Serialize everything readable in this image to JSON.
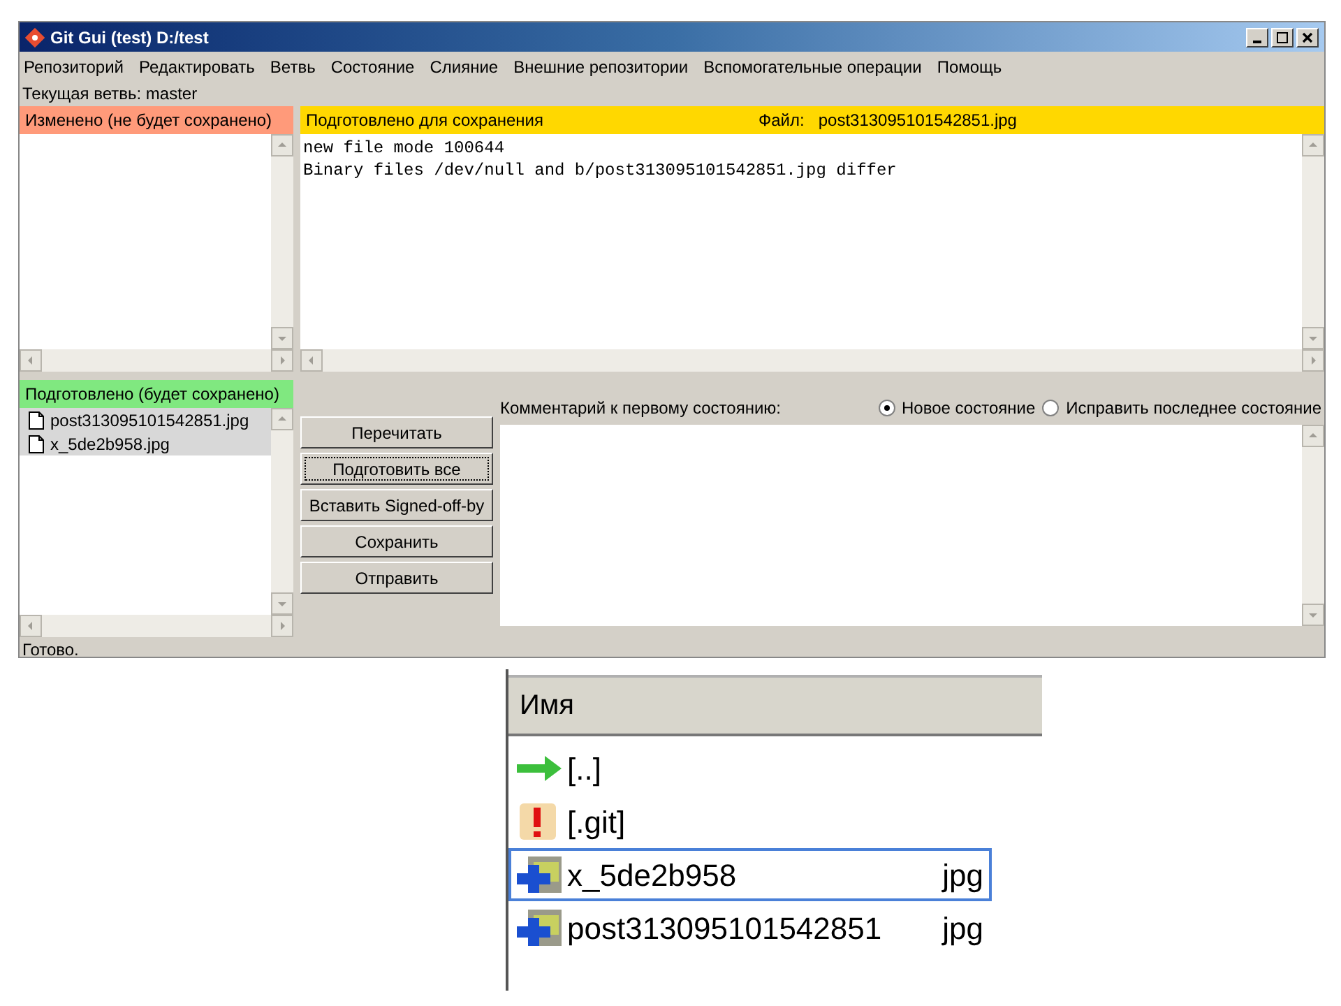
{
  "window": {
    "title": "Git Gui (test) D:/test"
  },
  "menu": [
    "Репозиторий",
    "Редактировать",
    "Ветвь",
    "Состояние",
    "Слияние",
    "Внешние репозитории",
    "Вспомогательные операции",
    "Помощь"
  ],
  "branch": "Текущая ветвь: master",
  "unstaged": {
    "title": "Изменено (не будет сохранено)"
  },
  "diff": {
    "title": "Подготовлено для сохранения",
    "file_label": "Файл:",
    "file": "post313095101542851.jpg",
    "lines": [
      "new file mode 100644",
      "Binary files /dev/null and b/post313095101542851.jpg differ"
    ]
  },
  "staged": {
    "title": "Подготовлено (будет сохранено)",
    "files": [
      {
        "name": "post313095101542851.jpg",
        "selected": true
      },
      {
        "name": "x_5de2b958.jpg",
        "selected": true
      }
    ]
  },
  "buttons": [
    {
      "label": "Перечитать",
      "focused": false
    },
    {
      "label": "Подготовить все",
      "focused": true
    },
    {
      "label": "Вставить Signed-off-by",
      "focused": false
    },
    {
      "label": "Сохранить",
      "focused": false
    },
    {
      "label": "Отправить",
      "focused": false
    }
  ],
  "commit": {
    "label": "Комментарий к первому состоянию:",
    "options": [
      {
        "label": "Новое состояние",
        "selected": true
      },
      {
        "label": "Исправить последнее состояние",
        "selected": false
      }
    ]
  },
  "status_bar": "Готово.",
  "file_manager": {
    "column": "Имя",
    "rows": [
      {
        "kind": "up",
        "name": "[..]",
        "selected": false
      },
      {
        "kind": "folder",
        "name": "[.git]",
        "selected": false
      },
      {
        "kind": "file",
        "name": "x_5de2b958",
        "ext": "jpg",
        "selected": true
      },
      {
        "kind": "file",
        "name": "post313095101542851",
        "ext": "jpg",
        "selected": false
      }
    ]
  }
}
